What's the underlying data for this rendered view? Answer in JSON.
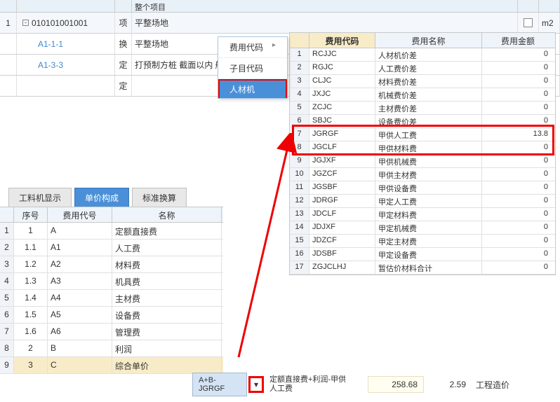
{
  "top": {
    "header": {
      "project": "整个项目"
    },
    "rows": [
      {
        "idx": "1",
        "code": "010101001001",
        "unit": "项",
        "name": "平整场地",
        "m2": "m2",
        "hasExpander": true,
        "indent": 0
      },
      {
        "idx": "",
        "code": "A1-1-1",
        "unit": "换",
        "name": "平整场地",
        "indent": 1,
        "link": true
      },
      {
        "idx": "",
        "code": "A1-3-3",
        "unit": "定",
        "name": "打预制方桩 截面以内 船上",
        "indent": 1,
        "link": true
      },
      {
        "idx": "",
        "code": "",
        "unit": "定",
        "name": "",
        "indent": 1
      }
    ]
  },
  "popup": {
    "items": [
      {
        "label": "费用代码",
        "exp": true
      },
      {
        "label": "子目代码"
      },
      {
        "label": "人材机",
        "selected": true
      }
    ]
  },
  "fee_table": {
    "headers": {
      "seq": "",
      "code": "费用代码",
      "name": "费用名称",
      "amount": "费用金额"
    },
    "rows": [
      {
        "seq": "1",
        "code": "RCJJC",
        "name": "人材机价差",
        "amt": "0"
      },
      {
        "seq": "2",
        "code": "RGJC",
        "name": "人工费价差",
        "amt": "0"
      },
      {
        "seq": "3",
        "code": "CLJC",
        "name": "材料费价差",
        "amt": "0"
      },
      {
        "seq": "4",
        "code": "JXJC",
        "name": "机械费价差",
        "amt": "0"
      },
      {
        "seq": "5",
        "code": "ZCJC",
        "name": "主材费价差",
        "amt": "0"
      },
      {
        "seq": "6",
        "code": "SBJC",
        "name": "设备费价差",
        "amt": "0"
      },
      {
        "seq": "7",
        "code": "JGRGF",
        "name": "甲供人工费",
        "amt": "13.8"
      },
      {
        "seq": "8",
        "code": "JGCLF",
        "name": "甲供材料费",
        "amt": "0"
      },
      {
        "seq": "9",
        "code": "JGJXF",
        "name": "甲供机械费",
        "amt": "0"
      },
      {
        "seq": "10",
        "code": "JGZCF",
        "name": "甲供主材费",
        "amt": "0"
      },
      {
        "seq": "11",
        "code": "JGSBF",
        "name": "甲供设备费",
        "amt": "0"
      },
      {
        "seq": "12",
        "code": "JDRGF",
        "name": "甲定人工费",
        "amt": "0"
      },
      {
        "seq": "13",
        "code": "JDCLF",
        "name": "甲定材料费",
        "amt": "0"
      },
      {
        "seq": "14",
        "code": "JDJXF",
        "name": "甲定机械费",
        "amt": "0"
      },
      {
        "seq": "15",
        "code": "JDZCF",
        "name": "甲定主材费",
        "amt": "0"
      },
      {
        "seq": "16",
        "code": "JDSBF",
        "name": "甲定设备费",
        "amt": "0"
      },
      {
        "seq": "17",
        "code": "ZGJCLHJ",
        "name": "暂估价材料合计",
        "amt": "0"
      }
    ]
  },
  "tabs": [
    {
      "label": "工料机显示"
    },
    {
      "label": "单价构成",
      "active": true
    },
    {
      "label": "标准换算"
    }
  ],
  "ll_table": {
    "headers": {
      "seq": "序号",
      "code": "费用代号",
      "name": "名称"
    },
    "rows": [
      {
        "idx": "1",
        "num": "1",
        "code": "A",
        "name": "定额直接费"
      },
      {
        "idx": "2",
        "num": "1.1",
        "code": "A1",
        "name": "人工费"
      },
      {
        "idx": "3",
        "num": "1.2",
        "code": "A2",
        "name": "材料费"
      },
      {
        "idx": "4",
        "num": "1.3",
        "code": "A3",
        "name": "机具费"
      },
      {
        "idx": "5",
        "num": "1.4",
        "code": "A4",
        "name": "主材费"
      },
      {
        "idx": "6",
        "num": "1.5",
        "code": "A5",
        "name": "设备费"
      },
      {
        "idx": "7",
        "num": "1.6",
        "code": "A6",
        "name": "管理费"
      },
      {
        "idx": "8",
        "num": "2",
        "code": "B",
        "name": "利润"
      },
      {
        "idx": "9",
        "num": "3",
        "code": "C",
        "name": "综合单价",
        "sel": true
      }
    ]
  },
  "bottom": {
    "formula": "A+B-JGRGF",
    "desc": "定额直接费+利润-甲供人工费",
    "val1": "258.68",
    "val2": "2.59",
    "label": "工程造价"
  }
}
